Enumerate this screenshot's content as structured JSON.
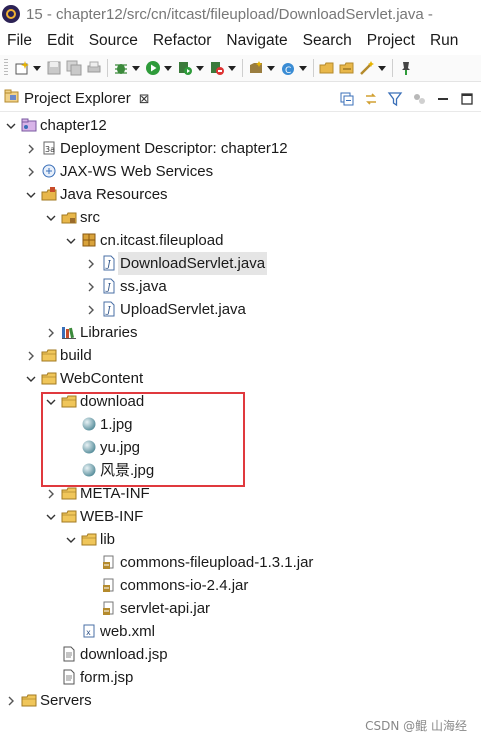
{
  "window": {
    "title": "15 - chapter12/src/cn/itcast/fileupload/DownloadServlet.java -"
  },
  "menu": [
    "File",
    "Edit",
    "Source",
    "Refactor",
    "Navigate",
    "Search",
    "Project",
    "Run"
  ],
  "view": {
    "tab_label": "Project Explorer",
    "close_glyph": "⊠"
  },
  "tree": [
    {
      "label": "chapter12",
      "icon": "project-icon",
      "twisty": "expanded"
    },
    {
      "label": "Deployment Descriptor: chapter12",
      "icon": "deployment-descriptor-icon",
      "twisty": "collapsed"
    },
    {
      "label": "JAX-WS Web Services",
      "icon": "web-services-icon",
      "twisty": "collapsed"
    },
    {
      "label": "Java Resources",
      "icon": "java-resources-icon",
      "twisty": "expanded"
    },
    {
      "label": "src",
      "icon": "source-folder-icon",
      "twisty": "expanded"
    },
    {
      "label": "cn.itcast.fileupload",
      "icon": "package-icon",
      "twisty": "expanded"
    },
    {
      "label": "DownloadServlet.java",
      "icon": "java-file-icon",
      "twisty": "collapsed"
    },
    {
      "label": "ss.java",
      "icon": "java-file-icon",
      "twisty": "collapsed"
    },
    {
      "label": "UploadServlet.java",
      "icon": "java-file-icon",
      "twisty": "collapsed"
    },
    {
      "label": "Libraries",
      "icon": "libraries-icon",
      "twisty": "collapsed"
    },
    {
      "label": "build",
      "icon": "folder-icon",
      "twisty": "collapsed"
    },
    {
      "label": "WebContent",
      "icon": "folder-icon",
      "twisty": "expanded"
    },
    {
      "label": "download",
      "icon": "folder-icon",
      "twisty": "expanded"
    },
    {
      "label": "1.jpg",
      "icon": "image-file-icon",
      "twisty": "none"
    },
    {
      "label": "yu.jpg",
      "icon": "image-file-icon",
      "twisty": "none"
    },
    {
      "label": "风景.jpg",
      "icon": "image-file-icon",
      "twisty": "none"
    },
    {
      "label": "META-INF",
      "icon": "folder-icon",
      "twisty": "collapsed"
    },
    {
      "label": "WEB-INF",
      "icon": "folder-icon",
      "twisty": "expanded"
    },
    {
      "label": "lib",
      "icon": "folder-icon",
      "twisty": "expanded"
    },
    {
      "label": "commons-fileupload-1.3.1.jar",
      "icon": "jar-file-icon",
      "twisty": "none"
    },
    {
      "label": "commons-io-2.4.jar",
      "icon": "jar-file-icon",
      "twisty": "none"
    },
    {
      "label": "servlet-api.jar",
      "icon": "jar-file-icon",
      "twisty": "none"
    },
    {
      "label": "web.xml",
      "icon": "xml-file-icon",
      "twisty": "none"
    },
    {
      "label": "download.jsp",
      "icon": "jsp-file-icon",
      "twisty": "none"
    },
    {
      "label": "form.jsp",
      "icon": "jsp-file-icon",
      "twisty": "none"
    },
    {
      "label": "Servers",
      "icon": "folder-icon",
      "twisty": "collapsed"
    }
  ],
  "selected_item": "DownloadServlet.java",
  "watermark": "CSDN @鲲  山海经",
  "colors": {
    "highlight_box": "#e0393e",
    "selection": "#e5e5e5",
    "folder": "#e8b74a"
  }
}
